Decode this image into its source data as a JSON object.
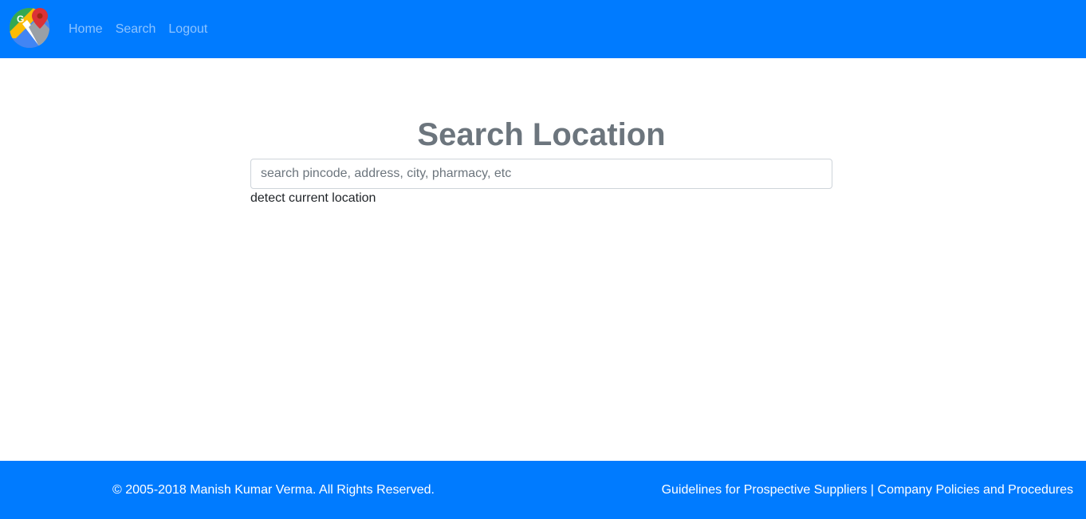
{
  "navbar": {
    "logo_icon": "google-maps-pin-icon",
    "brand_color": "#007bff",
    "links": [
      "Home",
      "Search",
      "Logout"
    ]
  },
  "main": {
    "title": "Search Location",
    "search_placeholder": "search pincode, address, city, pharmacy, etc",
    "search_value": "",
    "detect_label": "detect current location"
  },
  "footer": {
    "copyright": "© 2005-2018 Manish Kumar Verma. All Rights Reserved.",
    "link_guidelines": "Guidelines for Prospective Suppliers",
    "separator": "|",
    "link_policies": "Company Policies and Procedures"
  }
}
